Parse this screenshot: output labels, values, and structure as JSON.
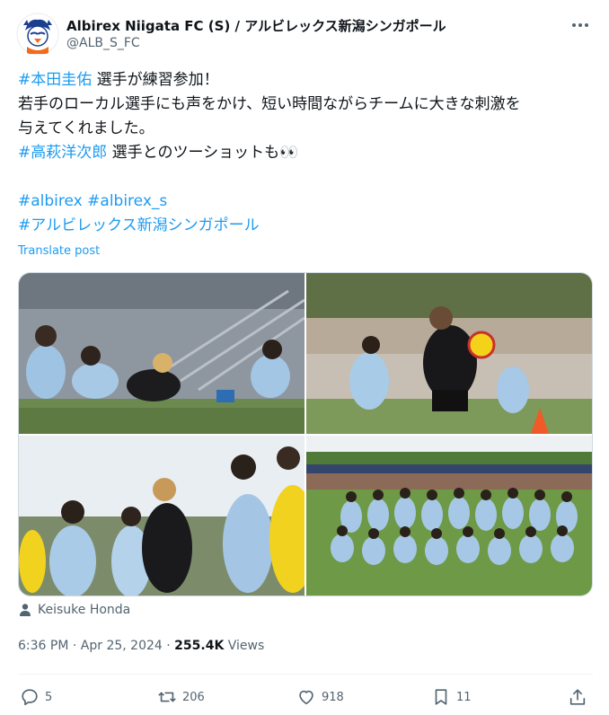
{
  "account": {
    "display_name": "Albirex Niigata FC (S) / アルビレックス新潟シンガポール",
    "handle": "@ALB_S_FC",
    "avatar_icon": "albirex-mascot-icon"
  },
  "menu": {
    "more_icon": "more-dots-icon"
  },
  "post": {
    "l1_tag": "#本田圭佑",
    "l1_text": " 選手が練習参加！",
    "l2_text": "若手のローカル選手にも声をかけ、短い時間ながらチームに大きな刺激を",
    "l3_text": "与えてくれました。",
    "l4_tag": "#高萩洋次郎",
    "l4_text": " 選手とのツーショットも👀",
    "tag_a": "#albirex",
    "tag_b": "#albirex_s",
    "tag_c": "#アルビレックス新潟シンガポール",
    "translate_label": "Translate post"
  },
  "media": {
    "photos": [
      {
        "subject": "players stretching on training pitch"
      },
      {
        "subject": "player juggling a yellow ball"
      },
      {
        "subject": "players gathered in a huddle"
      },
      {
        "subject": "squad team photo on field"
      }
    ]
  },
  "credit": {
    "name": "Keisuke Honda",
    "icon": "person-icon"
  },
  "meta": {
    "time": "6:36 PM",
    "date": "Apr 25, 2024",
    "views_count": "255.4K",
    "views_label": "Views"
  },
  "actions": {
    "replies": "5",
    "reposts": "206",
    "likes": "918",
    "bookmarks": "11"
  },
  "colors": {
    "accent": "#1d9bf0",
    "text": "#0f1419",
    "secondary": "#536471",
    "border": "#cfd9de"
  }
}
